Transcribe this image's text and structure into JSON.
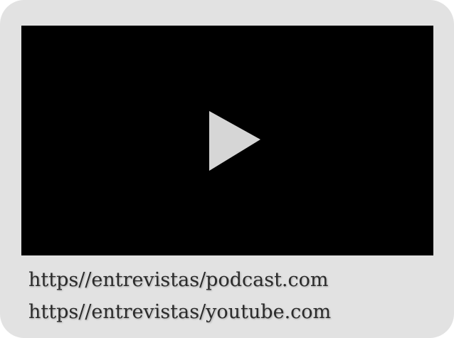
{
  "colors": {
    "card_background": "#e2e2e2",
    "player_background": "#000000",
    "play_icon": "#d6d6d6",
    "link_text": "#2b2b2b"
  },
  "player": {
    "icon": "play-icon"
  },
  "links": [
    {
      "text": "https//entrevistas/podcast.com"
    },
    {
      "text": "https//entrevistas/youtube.com"
    }
  ]
}
